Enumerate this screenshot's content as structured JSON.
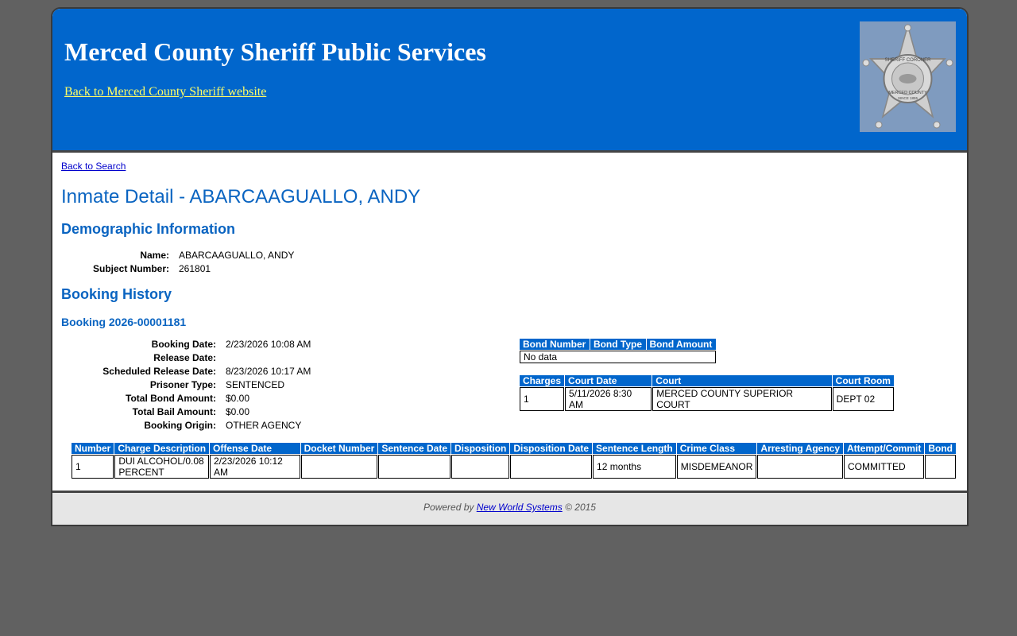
{
  "header": {
    "title": "Merced County Sheriff Public Services",
    "back_link": "Back to Merced County Sheriff website",
    "badge": {
      "icon": "sheriff-star-badge",
      "top_text": "SHERIFF CORONER",
      "bottom_text": "MERCED COUNTY",
      "since_text": "SINCE 1855"
    }
  },
  "nav": {
    "back_to_search": "Back to Search"
  },
  "page_title": "Inmate Detail - ABARCAAGUALLO, ANDY",
  "demographic": {
    "heading": "Demographic Information",
    "name_label": "Name:",
    "name_value": "ABARCAAGUALLO, ANDY",
    "subject_label": "Subject Number:",
    "subject_value": "261801"
  },
  "booking_history": {
    "heading": "Booking History",
    "booking_number": "Booking 2026-00001181",
    "fields": [
      {
        "label": "Booking Date:",
        "value": "2/23/2026 10:08 AM"
      },
      {
        "label": "Release Date:",
        "value": ""
      },
      {
        "label": "Scheduled Release Date:",
        "value": "8/23/2026 10:17 AM"
      },
      {
        "label": "Prisoner Type:",
        "value": "SENTENCED"
      },
      {
        "label": "Total Bond Amount:",
        "value": "$0.00"
      },
      {
        "label": "Total Bail Amount:",
        "value": "$0.00"
      },
      {
        "label": "Booking Origin:",
        "value": "OTHER AGENCY"
      }
    ]
  },
  "bond_table": {
    "headers": [
      "Bond Number",
      "Bond Type",
      "Bond Amount"
    ],
    "empty_text": "No data"
  },
  "court_table": {
    "headers": [
      "Charges",
      "Court Date",
      "Court",
      "Court Room"
    ],
    "rows": [
      [
        "1",
        "5/11/2026 8:30 AM",
        "MERCED COUNTY SUPERIOR COURT",
        "DEPT 02"
      ]
    ]
  },
  "charges_table": {
    "headers": [
      "Number",
      "Charge Description",
      "Offense Date",
      "Docket Number",
      "Sentence Date",
      "Disposition",
      "Disposition Date",
      "Sentence Length",
      "Crime Class",
      "Arresting Agency",
      "Attempt/Commit",
      "Bond"
    ],
    "rows": [
      [
        "1",
        "DUI ALCOHOL/0.08 PERCENT",
        "2/23/2026 10:12 AM",
        "",
        "",
        "",
        "",
        "12 months",
        "MISDEMEANOR",
        "",
        "COMMITTED",
        ""
      ]
    ]
  },
  "footer": {
    "powered_by": "Powered by",
    "link": "New World Systems",
    "copyright": "© 2015"
  }
}
